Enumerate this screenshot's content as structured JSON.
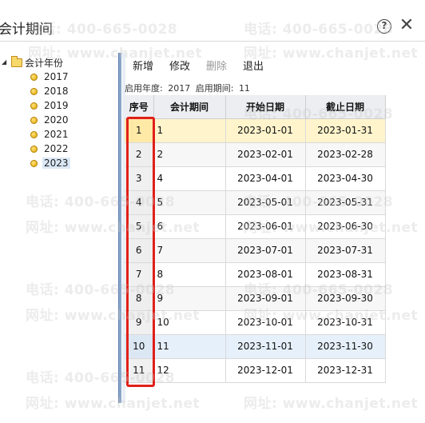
{
  "window": {
    "title": "会计期间",
    "help_label": "?",
    "close_label": "✕"
  },
  "tree": {
    "root_label": "会计年份",
    "items": [
      {
        "label": "2017"
      },
      {
        "label": "2018"
      },
      {
        "label": "2019"
      },
      {
        "label": "2020"
      },
      {
        "label": "2021"
      },
      {
        "label": "2022"
      },
      {
        "label": "2023",
        "selected": true
      }
    ]
  },
  "toolbar": {
    "add_label": "新增",
    "edit_label": "修改",
    "delete_label": "删除",
    "exit_label": "退出"
  },
  "info": {
    "year_label": "启用年度:",
    "year_value": "2017",
    "period_label": "启用期间:",
    "period_value": "11"
  },
  "table": {
    "headers": [
      "序号",
      "会计期间",
      "开始日期",
      "截止日期"
    ],
    "rows": [
      {
        "seq": "1",
        "period": "1",
        "start": "2023-01-01",
        "end": "2023-01-31"
      },
      {
        "seq": "2",
        "period": "2",
        "start": "2023-02-01",
        "end": "2023-02-28"
      },
      {
        "seq": "3",
        "period": "4",
        "start": "2023-04-01",
        "end": "2023-04-30"
      },
      {
        "seq": "4",
        "period": "5",
        "start": "2023-05-01",
        "end": "2023-05-31"
      },
      {
        "seq": "5",
        "period": "6",
        "start": "2023-06-01",
        "end": "2023-06-30"
      },
      {
        "seq": "6",
        "period": "7",
        "start": "2023-07-01",
        "end": "2023-07-31"
      },
      {
        "seq": "7",
        "period": "8",
        "start": "2023-08-01",
        "end": "2023-08-31"
      },
      {
        "seq": "8",
        "period": "9",
        "start": "2023-09-01",
        "end": "2023-09-30"
      },
      {
        "seq": "9",
        "period": "10",
        "start": "2023-10-01",
        "end": "2023-10-31"
      },
      {
        "seq": "10",
        "period": "11",
        "start": "2023-11-01",
        "end": "2023-11-30"
      },
      {
        "seq": "11",
        "period": "12",
        "start": "2023-12-01",
        "end": "2023-12-31"
      }
    ]
  },
  "watermark": {
    "phone": "电话: 400-665-0028",
    "site": "网址: www.chanjet.net"
  },
  "colors": {
    "highlight": "#e0201a",
    "selected_row": "#fff4cc",
    "hover_row": "#e6f0fb"
  }
}
